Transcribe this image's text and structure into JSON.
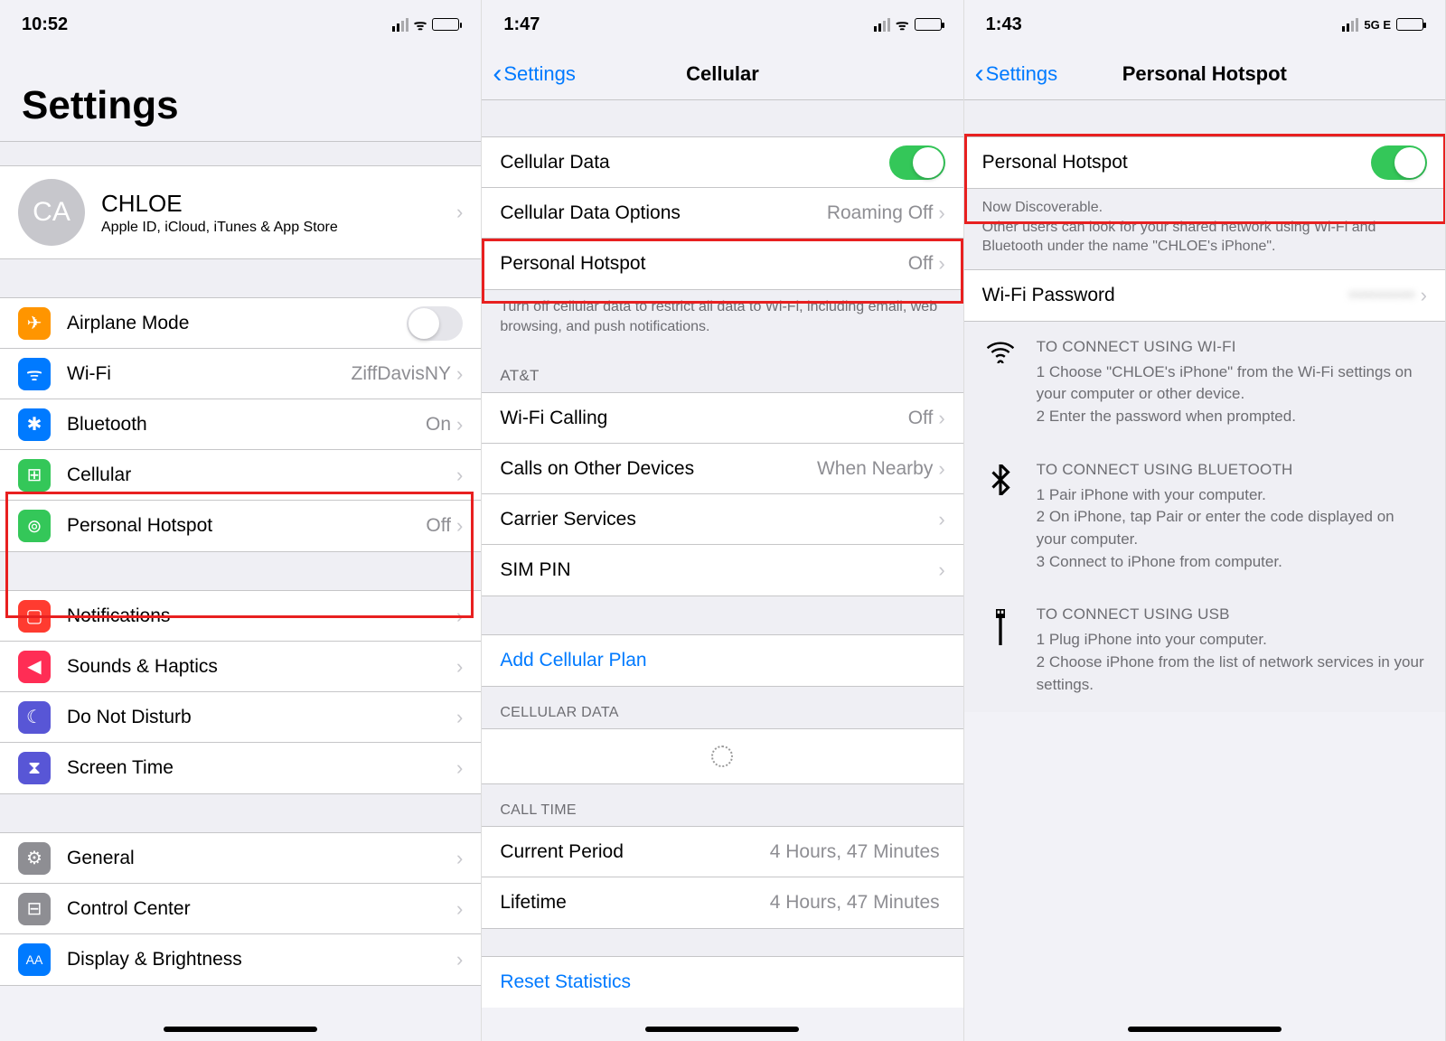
{
  "screen1": {
    "time": "10:52",
    "title": "Settings",
    "profile": {
      "initials": "CA",
      "name": "CHLOE",
      "sub": "Apple ID, iCloud, iTunes & App Store"
    },
    "rows1": [
      {
        "icon": "✈",
        "color": "#ff9500",
        "label": "Airplane Mode",
        "toggle": false
      },
      {
        "icon": "ᯤ",
        "color": "#007aff",
        "label": "Wi-Fi",
        "value": "ZiffDavisNY"
      },
      {
        "icon": "✱",
        "color": "#007aff",
        "label": "Bluetooth",
        "value": "On"
      },
      {
        "icon": "⊞",
        "color": "#34c759",
        "label": "Cellular"
      },
      {
        "icon": "⊚",
        "color": "#34c759",
        "label": "Personal Hotspot",
        "value": "Off"
      }
    ],
    "rows2": [
      {
        "icon": "▢",
        "color": "#ff3b30",
        "label": "Notifications"
      },
      {
        "icon": "◀",
        "color": "#ff2d55",
        "label": "Sounds & Haptics"
      },
      {
        "icon": "☾",
        "color": "#5856d6",
        "label": "Do Not Disturb"
      },
      {
        "icon": "⧗",
        "color": "#5856d6",
        "label": "Screen Time"
      }
    ],
    "rows3": [
      {
        "icon": "⚙",
        "color": "#8e8e93",
        "label": "General"
      },
      {
        "icon": "⊟",
        "color": "#8e8e93",
        "label": "Control Center"
      },
      {
        "icon": "AA",
        "color": "#007aff",
        "label": "Display & Brightness"
      }
    ]
  },
  "screen2": {
    "time": "1:47",
    "back": "Settings",
    "title": "Cellular",
    "group1": [
      {
        "label": "Cellular Data",
        "toggle": true
      },
      {
        "label": "Cellular Data Options",
        "value": "Roaming Off"
      },
      {
        "label": "Personal Hotspot",
        "value": "Off"
      }
    ],
    "footer1": "Turn off cellular data to restrict all data to Wi-Fi, including email, web browsing, and push notifications.",
    "header2": "AT&T",
    "group2": [
      {
        "label": "Wi-Fi Calling",
        "value": "Off"
      },
      {
        "label": "Calls on Other Devices",
        "value": "When Nearby"
      },
      {
        "label": "Carrier Services"
      },
      {
        "label": "SIM PIN"
      }
    ],
    "addPlan": "Add Cellular Plan",
    "header3": "CELLULAR DATA",
    "header4": "CALL TIME",
    "group4": [
      {
        "label": "Current Period",
        "value": "4 Hours, 47 Minutes"
      },
      {
        "label": "Lifetime",
        "value": "4 Hours, 47 Minutes"
      }
    ],
    "reset": "Reset Statistics"
  },
  "screen3": {
    "time": "1:43",
    "network": "5G E",
    "back": "Settings",
    "title": "Personal Hotspot",
    "toggleLabel": "Personal Hotspot",
    "discoverable": "Now Discoverable.",
    "discoverableSub": "Other users can look for your shared network using Wi-Fi and Bluetooth under the name \"CHLOE's iPhone\".",
    "wifiPassLabel": "Wi-Fi Password",
    "wifiPassValue": "••••••••••",
    "info": [
      {
        "icon": "wifi",
        "head": "TO CONNECT USING WI-FI",
        "lines": [
          "1 Choose \"CHLOE's iPhone\" from the Wi-Fi settings on your computer or other device.",
          "2 Enter the password when prompted."
        ]
      },
      {
        "icon": "bluetooth",
        "head": "TO CONNECT USING BLUETOOTH",
        "lines": [
          "1 Pair iPhone with your computer.",
          "2 On iPhone, tap Pair or enter the code displayed on your computer.",
          "3 Connect to iPhone from computer."
        ]
      },
      {
        "icon": "usb",
        "head": "TO CONNECT USING USB",
        "lines": [
          "1 Plug iPhone into your computer.",
          "2 Choose iPhone from the list of network services in your settings."
        ]
      }
    ]
  }
}
